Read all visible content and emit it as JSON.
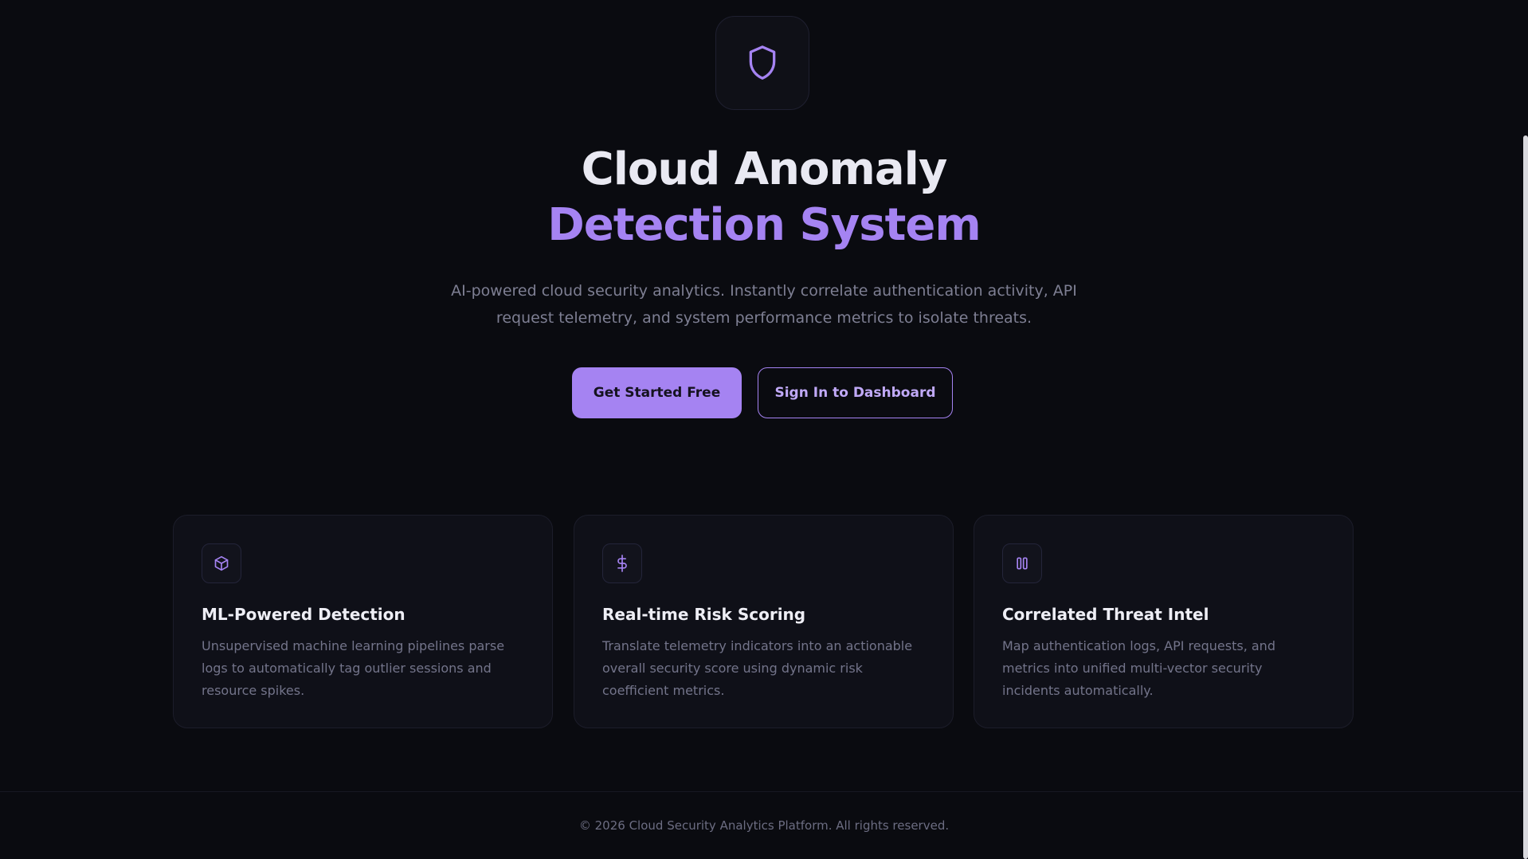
{
  "hero": {
    "icon": "shield-icon",
    "title_line1": "Cloud Anomaly",
    "title_line2": "Detection System",
    "subtitle": "AI-powered cloud security analytics. Instantly correlate authentication activity, API request telemetry, and system performance metrics to isolate threats.",
    "cta_primary": "Get Started Free",
    "cta_secondary": "Sign In to Dashboard"
  },
  "features": [
    {
      "icon": "cube-icon",
      "title": "ML-Powered Detection",
      "description": "Unsupervised machine learning pipelines parse logs to automatically tag outlier sessions and resource spikes."
    },
    {
      "icon": "dollar-icon",
      "title": "Real-time Risk Scoring",
      "description": "Translate telemetry indicators into an actionable overall security score using dynamic risk coefficient metrics."
    },
    {
      "icon": "columns-icon",
      "title": "Correlated Threat Intel",
      "description": "Map authentication logs, API requests, and metrics into unified multi-vector security incidents automatically."
    }
  ],
  "footer": {
    "copyright": "© 2026 Cloud Security Analytics Platform. All rights reserved."
  },
  "colors": {
    "background": "#0a0b10",
    "accent": "#a583f2",
    "card": "#0f1018",
    "muted_text": "#7e7f93"
  }
}
